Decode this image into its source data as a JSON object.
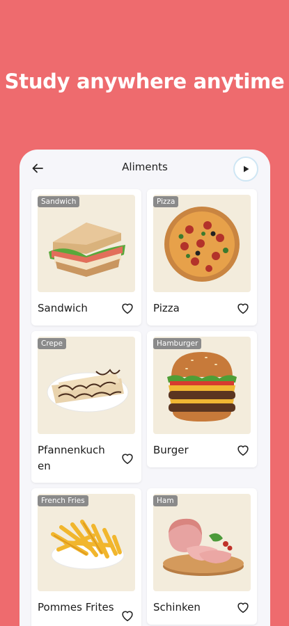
{
  "headline": "Study anywhere anytime",
  "appbar": {
    "title": "Aliments"
  },
  "colors": {
    "background": "#ee6b6e",
    "card_image_bg": "#f3ecdc",
    "tag_bg": "#8a8a8a"
  },
  "items": [
    {
      "tag": "Sandwich",
      "name": "Sandwich",
      "icon": "sandwich-image"
    },
    {
      "tag": "Pizza",
      "name": "Pizza",
      "icon": "pizza-image"
    },
    {
      "tag": "Crepe",
      "name": "Pfannenkuch en",
      "icon": "crepe-image"
    },
    {
      "tag": "Hamburger",
      "name": "Burger",
      "icon": "burger-image"
    },
    {
      "tag": "French Fries",
      "name": "Pommes Frites",
      "icon": "fries-image"
    },
    {
      "tag": "Ham",
      "name": "Schinken",
      "icon": "ham-image"
    }
  ]
}
